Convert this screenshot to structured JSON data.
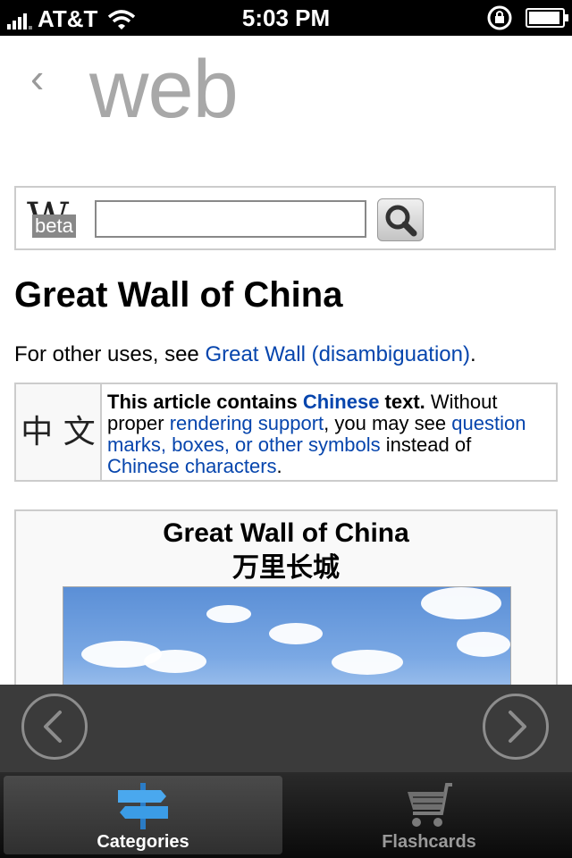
{
  "status_bar": {
    "carrier": "AT&T",
    "time": "5:03 PM",
    "battery_level": 0.85
  },
  "header": {
    "back_symbol": "‹",
    "title": "web"
  },
  "search": {
    "logo_letter": "W",
    "logo_badge": "beta",
    "value": "",
    "button_icon": "search-icon"
  },
  "article": {
    "title": "Great Wall of China",
    "hatnote": {
      "prefix": "For other uses, see ",
      "link": "Great Wall (disambiguation)",
      "suffix": "."
    },
    "notice": {
      "glyph": "中 文",
      "bold_start": "This article contains ",
      "bold_link": "Chinese",
      "bold_end": " text.",
      "t1": " Without proper ",
      "link1": "rendering support",
      "t2": ", you may see ",
      "link2": "question marks, boxes, or other symbols",
      "t3": " instead of ",
      "link3": "Chinese characters",
      "t4": "."
    },
    "infobox": {
      "title": "Great Wall of China",
      "chinese": "万里长城"
    }
  },
  "nav": {
    "prev_icon": "chevron-left-icon",
    "next_icon": "chevron-right-icon"
  },
  "tabs": [
    {
      "label": "Categories",
      "icon": "signpost-icon",
      "active": true
    },
    {
      "label": "Flashcards",
      "icon": "cart-icon",
      "active": false
    }
  ],
  "colors": {
    "link": "#0645ad",
    "tab_icon_active": "#3b9ce6",
    "navbar": "#3b3b3b"
  }
}
